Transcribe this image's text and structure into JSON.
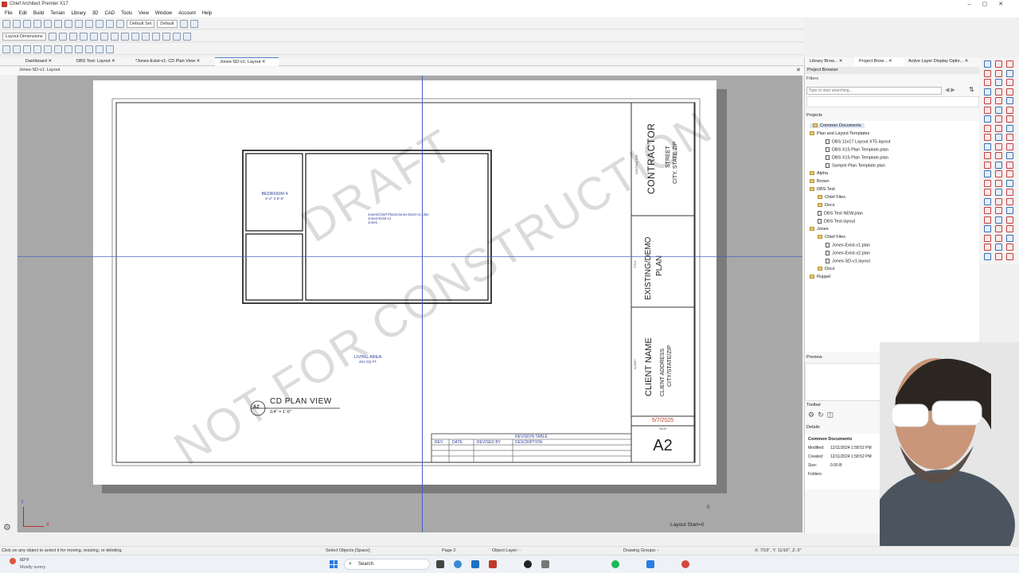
{
  "window": {
    "title": "Chief Architect Premier X17"
  },
  "menu": [
    "File",
    "Edit",
    "Build",
    "Terrain",
    "Library",
    "3D",
    "CAD",
    "Tools",
    "View",
    "Window",
    "Account",
    "Help"
  ],
  "toolbar": {
    "layer_set": "Default Set",
    "default_sel": "Default",
    "layout_dims": "Layout Dimensions"
  },
  "tabs": [
    "Dashboard",
    "DBS Test: Layout",
    "*Jones-Exist-v1: CD Plan View",
    "Jones-SD-v1: Layout"
  ],
  "view_label": "Jones-SD-v1: Layout",
  "sheet": {
    "watermark1": "DRAFT",
    "watermark2": "NOT FOR CONSTRUCTION",
    "room1_name": "BEDROOM 4",
    "room1_dims": "6'-2\" X 8'-6\"",
    "box_label_1": "Jones\\Chief Plans\\Jones-Exist-v1.plan",
    "box_label_2": "Jones-Exist-v1",
    "box_label_3": "Jones",
    "living_name": "LIVING AREA",
    "living_area": "461 SQ FT",
    "view_bubble": "A2",
    "view_title": "CD PLAN VIEW",
    "view_scale": "1/4\" = 1'-0\"",
    "revision_title": "REVISION TABLE",
    "revision_cols": [
      "REV",
      "DATE",
      "REVISED BY",
      "DESCRIPTION"
    ],
    "contractor_small": "CONTRACTOR",
    "contractor": "CONTRACTOR",
    "contractor_street": "STREET",
    "contractor_city": "CITY, STATE ZIP",
    "title_small": "TITLE",
    "title_main": "EXISTING/DEMO",
    "title_sub": "PLAN",
    "client_small": "CLIENT",
    "client_name": "CLIENT NAME",
    "client_address": "CLIENT ADDRESS",
    "client_city": "CITY/STATE/ZIP",
    "date": "5/7/2025",
    "page_small": "PAGE",
    "page": "A2"
  },
  "canvas": {
    "page_num": "0",
    "layout_start": "Layout Start=0",
    "axis_y": "Y",
    "axis_x": "X"
  },
  "right_panel": {
    "tabs": [
      "Library Brow...",
      "Project Brow...",
      "Active Layer Display Optio..."
    ],
    "header": "Project Browser",
    "filters": "Filters",
    "search_placeholder": "Type to start searching...",
    "projects_label": "Projects",
    "tree": [
      {
        "label": "Common Documents",
        "kind": "fold",
        "indent": 0,
        "selected": true
      },
      {
        "label": "Plan and Layout Templates",
        "kind": "fold",
        "indent": 0
      },
      {
        "label": "DBS 11x17 Layout XT5.layout",
        "kind": "file",
        "indent": 2
      },
      {
        "label": "DBS X15 Plan Template.plan",
        "kind": "file",
        "indent": 2
      },
      {
        "label": "DBS X15 Plan Template.plan",
        "kind": "file",
        "indent": 2
      },
      {
        "label": "Sample Plan Template.plan",
        "kind": "file",
        "indent": 2
      },
      {
        "label": "Alpha",
        "kind": "fold",
        "indent": 0
      },
      {
        "label": "Brown",
        "kind": "fold",
        "indent": 0
      },
      {
        "label": "DBS Test",
        "kind": "fold",
        "indent": 0
      },
      {
        "label": "Chief Files",
        "kind": "fold",
        "indent": 1
      },
      {
        "label": "Docs",
        "kind": "fold",
        "indent": 1
      },
      {
        "label": "DBS Test NEW.plan",
        "kind": "file",
        "indent": 1
      },
      {
        "label": "DBS Test.layout",
        "kind": "file",
        "indent": 1
      },
      {
        "label": "Jones",
        "kind": "fold",
        "indent": 0
      },
      {
        "label": "Chief Files",
        "kind": "fold",
        "indent": 1
      },
      {
        "label": "Jones-Exist-v1.plan",
        "kind": "file",
        "indent": 2
      },
      {
        "label": "Jones-Exist-v2.plan",
        "kind": "file",
        "indent": 2
      },
      {
        "label": "Jones-SD-v1.layout",
        "kind": "file",
        "indent": 2
      },
      {
        "label": "Docs",
        "kind": "fold",
        "indent": 1
      },
      {
        "label": "Ruppel",
        "kind": "fold",
        "indent": 0
      }
    ],
    "preview": "Preview",
    "toolbar": "Toolbar",
    "details": "Details",
    "details_title": "Common Documents",
    "modified_label": "Modified:",
    "modified": "12/11/2024 1:58:52 PM",
    "created_label": "Created:",
    "created": "12/11/2024 1:58:52 PM",
    "size_label": "Size:",
    "size": "0.00 B",
    "folders_label": "Folders:"
  },
  "status": {
    "hint": "Click on any object to select it for moving, resizing, or deleting.",
    "mode": "Select Objects [Space]",
    "page": "Page 2",
    "layer": "Object Layer: -",
    "groups": "Drawing Groups: -",
    "coords": "X: 7/16\", Y: 11/16\", Z: 0\""
  },
  "taskbar": {
    "temp": "60°F",
    "weather": "Mostly sunny",
    "search": "Search"
  }
}
